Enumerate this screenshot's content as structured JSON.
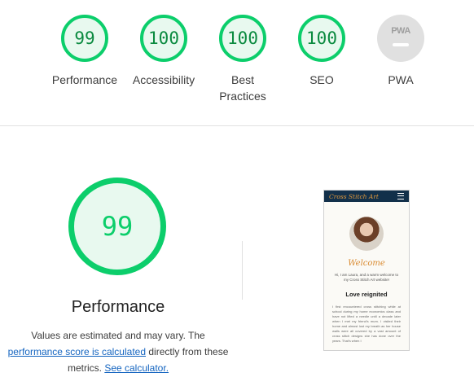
{
  "summary_gauges": [
    {
      "score": "99",
      "label": "Performance"
    },
    {
      "score": "100",
      "label": "Accessibility"
    },
    {
      "score": "100",
      "label": "Best Practices"
    },
    {
      "score": "100",
      "label": "SEO"
    },
    {
      "score": "",
      "label": "PWA",
      "badge": "PWA"
    }
  ],
  "performance": {
    "score": "99",
    "title": "Performance",
    "note_prefix": "Values are estimated and may vary. The",
    "note_link1": "performance score is calculated",
    "note_mid": "directly from these metrics.",
    "note_link2": "See calculator."
  },
  "thumbnail": {
    "logo": "Cross Stitch Art",
    "welcome": "Welcome",
    "intro": "Hi, I am Laura, and a warm welcome to my Cross Stitch Art website!",
    "heading": "Love reignited",
    "paragraph": "I first encountered cross stitching while at school during my home economics class and have not lifted a needle until a decade later when I met my friend's mum. I visited their home and almost lost my breath as her house walls were all covered by a vast amount of cross stitch designs she has done over the years. That's when I"
  },
  "colors": {
    "pass": "#0cce6b",
    "pass_bg": "#e8f9ef",
    "link": "#1565c0",
    "pwa_gray": "#e0e0e0"
  }
}
